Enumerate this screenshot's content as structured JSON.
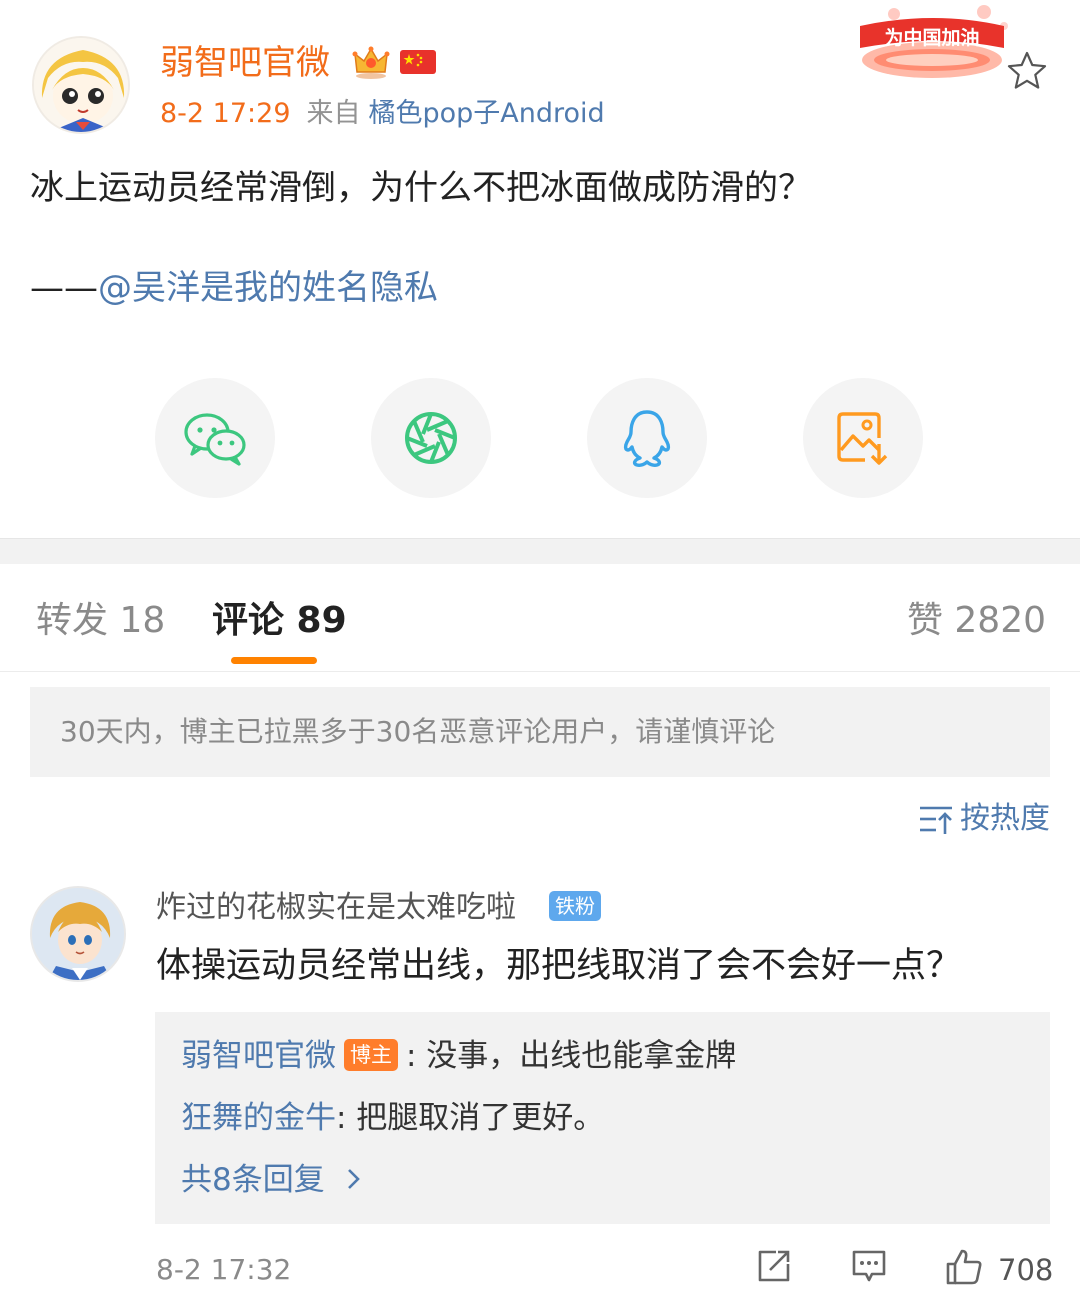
{
  "post": {
    "author": "弱智吧官微",
    "time": "8-2 17:29",
    "from_label": "来自",
    "client": "橘色pop子Android",
    "badge_text": "为中国加油",
    "text": "冰上运动员经常滑倒，为什么不把冰面做成防滑的？",
    "credit_prefix": "——",
    "credit_mention": "@吴洋是我的姓名隐私"
  },
  "share": {
    "icons": [
      "wechat-icon",
      "moments-icon",
      "qq-icon",
      "save-image-icon"
    ]
  },
  "tabs": {
    "repost": "转发 18",
    "comments": "评论 89",
    "likes": "赞 2820"
  },
  "notice": "30天内，博主已拉黑多于30名恶意评论用户，请谨慎评论",
  "sort_label": "按热度",
  "comment": {
    "user": "炸过的花椒实在是太难吃啦",
    "fan_badge": "铁粉",
    "text": "体操运动员经常出线，那把线取消了会不会好一点？",
    "replies": [
      {
        "name": "弱智吧官微",
        "badge": "博主",
        "text": ": 没事，出线也能拿金牌"
      },
      {
        "name": "狂舞的金牛",
        "badge": "",
        "text": ": 把腿取消了更好。"
      }
    ],
    "more_replies": "共8条回复",
    "time": "8-2 17:32",
    "likes": "708"
  },
  "colors": {
    "accent_orange": "#ff8200",
    "link_blue": "#4f7aae",
    "wechat_green": "#3cc77f",
    "qq_blue": "#3aa5e8",
    "save_orange": "#ff9a1f"
  }
}
